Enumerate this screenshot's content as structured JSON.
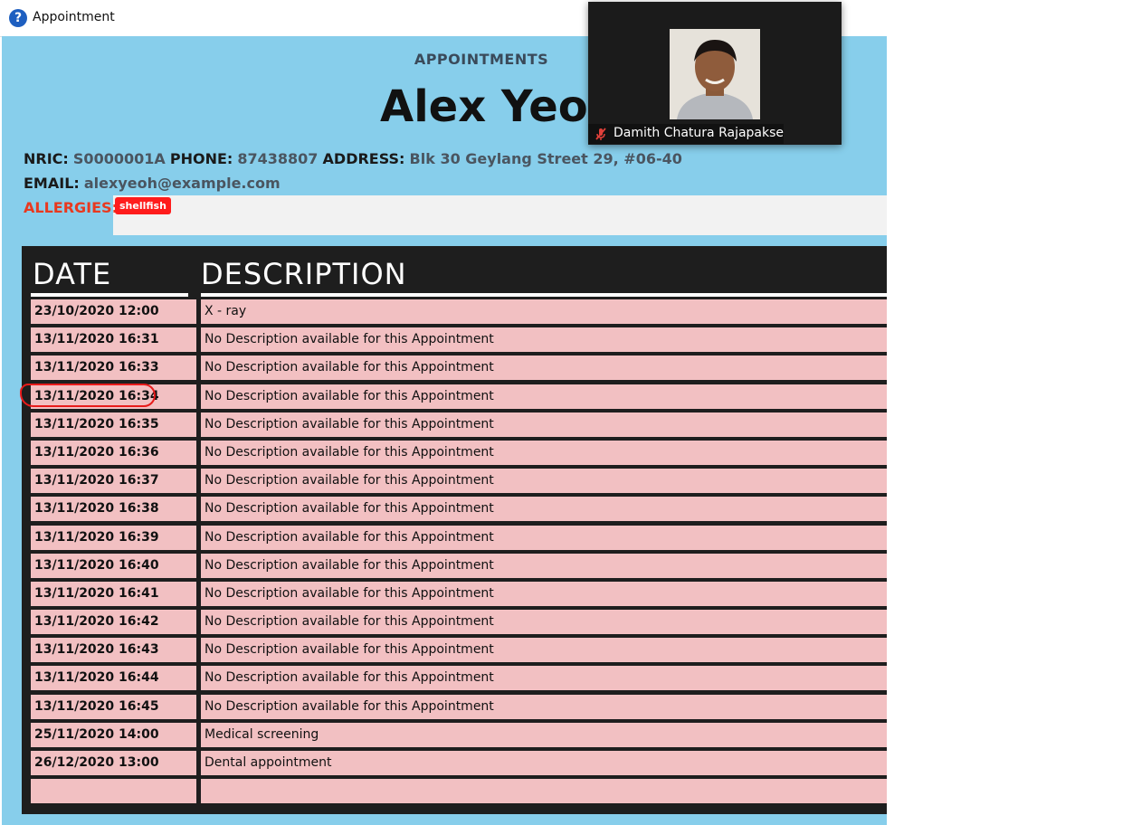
{
  "window": {
    "title": "Appointment",
    "icon": "help-question-icon"
  },
  "header": {
    "view_label": "APPOINTMENTS",
    "patient_name": "Alex Yeoh"
  },
  "patient": {
    "nric_label": "NRIC:",
    "nric": "S0000001A",
    "phone_label": "PHONE:",
    "phone": "87438807",
    "address_label": "ADDRESS:",
    "address": "Blk 30 Geylang Street 29, #06-40",
    "email_label": "EMAIL:",
    "email": "alexyeoh@example.com",
    "allergies_label": "ALLERGIES:",
    "allergies": [
      "shellfish"
    ]
  },
  "table": {
    "columns": [
      "DATE",
      "DESCRIPTION"
    ],
    "rows": [
      {
        "date": "23/10/2020 12:00",
        "description": "X - ray"
      },
      {
        "date": "13/11/2020 16:31",
        "description": "No Description available for this Appointment"
      },
      {
        "date": "13/11/2020 16:33",
        "description": "No Description available for this Appointment"
      },
      {
        "date": "13/11/2020 16:34",
        "description": "No Description available for this Appointment"
      },
      {
        "date": "13/11/2020 16:35",
        "description": "No Description available for this Appointment"
      },
      {
        "date": "13/11/2020 16:36",
        "description": "No Description available for this Appointment"
      },
      {
        "date": "13/11/2020 16:37",
        "description": "No Description available for this Appointment"
      },
      {
        "date": "13/11/2020 16:38",
        "description": "No Description available for this Appointment"
      },
      {
        "date": "13/11/2020 16:39",
        "description": "No Description available for this Appointment"
      },
      {
        "date": "13/11/2020 16:40",
        "description": "No Description available for this Appointment"
      },
      {
        "date": "13/11/2020 16:41",
        "description": "No Description available for this Appointment"
      },
      {
        "date": "13/11/2020 16:42",
        "description": "No Description available for this Appointment"
      },
      {
        "date": "13/11/2020 16:43",
        "description": "No Description available for this Appointment"
      },
      {
        "date": "13/11/2020 16:44",
        "description": "No Description available for this Appointment"
      },
      {
        "date": "13/11/2020 16:45",
        "description": "No Description available for this Appointment"
      },
      {
        "date": "25/11/2020 14:00",
        "description": "Medical screening"
      },
      {
        "date": "26/12/2020 13:00",
        "description": "Dental appointment"
      },
      {
        "date": "",
        "description": ""
      }
    ]
  },
  "video_overlay": {
    "participant_name": "Damith Chatura Rajapakse",
    "mic_icon": "mic-muted-icon"
  },
  "colors": {
    "panel_bg": "#87ceeb",
    "row_bg": "#f2c0c2",
    "allergy_label": "#e8391f",
    "allergy_tag": "#ff1c1c",
    "annotation": "#e81b1b"
  }
}
